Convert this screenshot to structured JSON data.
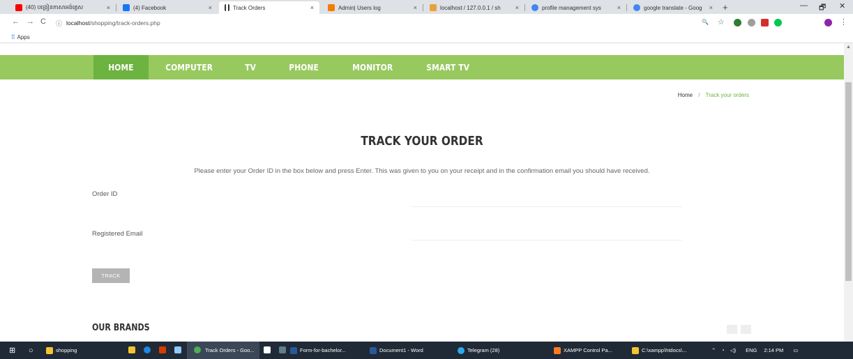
{
  "browser": {
    "tabs": [
      {
        "title": "(40) បង្រៀនភាសាអង់គ្លេស",
        "favicon_color": "#ff0000"
      },
      {
        "title": "(4) Facebook",
        "favicon_color": "#1877f2"
      },
      {
        "title": "Track Orders",
        "favicon_color": "#333333"
      },
      {
        "title": "Admin| Users log",
        "favicon_color": "#f57c00"
      },
      {
        "title": "localhost / 127.0.0.1 / sh",
        "favicon_color": "#e8a13a"
      },
      {
        "title": "profile management sys",
        "favicon_color": "#4285f4"
      },
      {
        "title": "google translate - Goog",
        "favicon_color": "#4285f4"
      }
    ],
    "close_glyph": "×",
    "new_tab_glyph": "+",
    "window_controls": {
      "minimize": "—",
      "maximize": "🗗",
      "close": "✕"
    },
    "nav": {
      "back": "←",
      "forward": "→",
      "reload": "C",
      "info": "ⓘ"
    },
    "url_host": "localhost",
    "url_path": "/shopping/track-orders.php",
    "omnibox_icons": {
      "zoom": "🔍",
      "star": "☆"
    },
    "extension_colors": [
      "#2e7d32",
      "#9e9e9e",
      "#d32f2f",
      "#00c853",
      "#8e24aa"
    ],
    "bookmarks_apps_label": "Apps",
    "apps_grid": "⁞⁞⁞"
  },
  "page": {
    "nav_items": [
      "HOME",
      "COMPUTER",
      "TV",
      "PHONE",
      "MONITOR",
      "SMART TV"
    ],
    "active_nav": "HOME",
    "breadcrumb": {
      "home": "Home",
      "separator": "/",
      "current": "Track your orders"
    },
    "heading": "TRACK YOUR ORDER",
    "instructions": "Please enter your Order ID in the box below and press Enter. This was given to you on your receipt and in the confirmation email you should have received.",
    "order_id_label": "Order ID",
    "order_id_value": "",
    "email_label": "Registered Email",
    "email_value": "",
    "track_button": "TRACK",
    "brands_heading": "OUR BRANDS",
    "accent_color": "#97c95f",
    "active_nav_color": "#6db33f"
  },
  "taskbar": {
    "items": [
      {
        "label": "shopping",
        "icon_color": "#f4c430"
      },
      {
        "label": "Track Orders - Goo...",
        "icon_color": "#4caf50",
        "active": true
      },
      {
        "label": "Form-for-bachelor...",
        "icon_color": "#2b579a"
      },
      {
        "label": "Document1 - Word",
        "icon_color": "#2b579a"
      },
      {
        "label": "Telegram (28)",
        "icon_color": "#2aabee"
      },
      {
        "label": "XAMPP Control Pa...",
        "icon_color": "#fb7a24"
      },
      {
        "label": "C:\\xampp\\htdocs\\...",
        "icon_color": "#f4c430"
      }
    ],
    "language": "ENG",
    "time": "2:14 PM",
    "start_glyph": "⊞",
    "search_glyph": "○"
  }
}
